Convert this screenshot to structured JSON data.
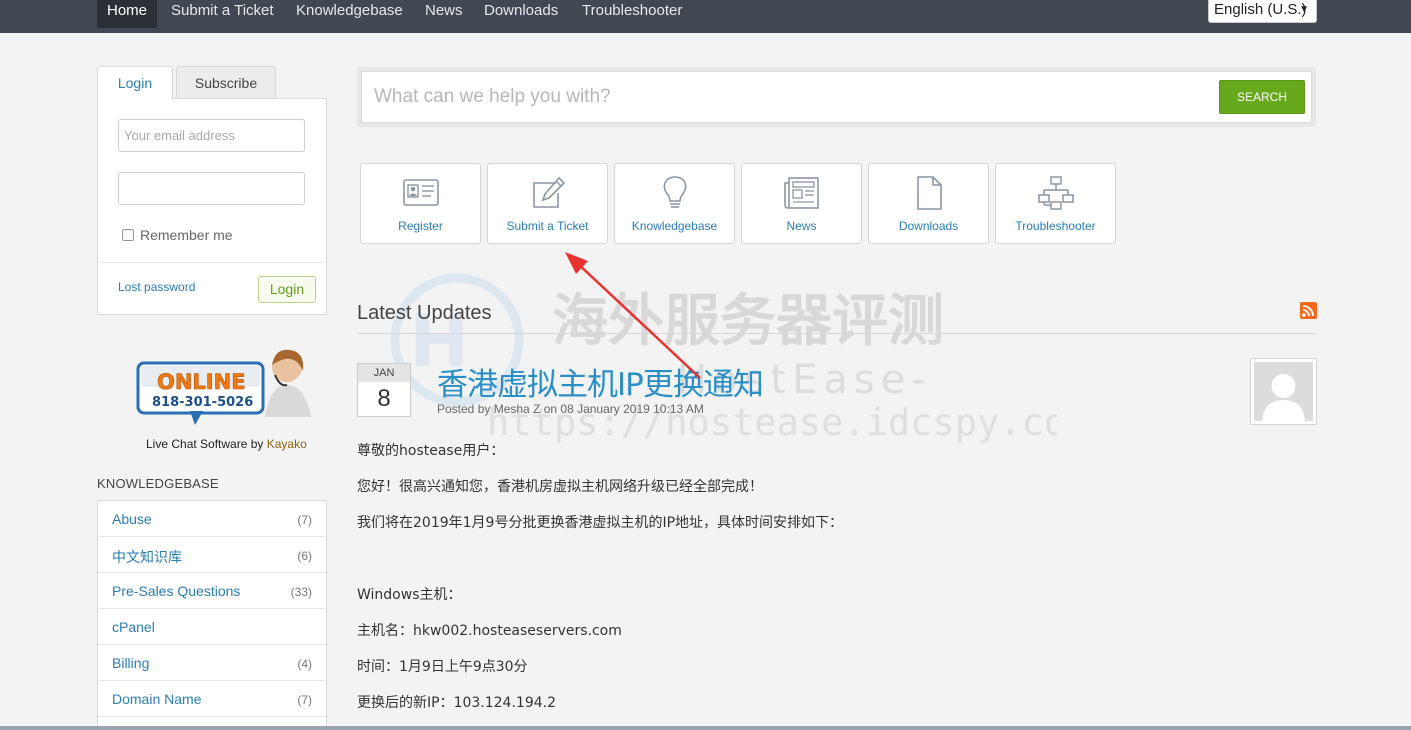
{
  "nav": {
    "items": [
      "Home",
      "Submit a Ticket",
      "Knowledgebase",
      "News",
      "Downloads",
      "Troubleshooter"
    ],
    "language": "English (U.S.)"
  },
  "login": {
    "tab_login": "Login",
    "tab_subscribe": "Subscribe",
    "email_placeholder": "Your email address",
    "password_value": "",
    "remember_label": "Remember me",
    "lost_password": "Lost password",
    "login_button": "Login"
  },
  "livechat": {
    "badge_text": "ONLINE",
    "phone": "818-301-5026",
    "caption_prefix": "Live Chat Software by",
    "caption_brand": "Kayako"
  },
  "knowledgebase": {
    "heading": "KNOWLEDGEBASE",
    "items": [
      {
        "label": "Abuse",
        "count": "(7)"
      },
      {
        "label": "中文知识库",
        "count": "(6)"
      },
      {
        "label": "Pre-Sales Questions",
        "count": "(33)"
      },
      {
        "label": "cPanel",
        "count": ""
      },
      {
        "label": "Billing",
        "count": "(4)"
      },
      {
        "label": "Domain Name",
        "count": "(7)"
      }
    ]
  },
  "search": {
    "placeholder": "What can we help you with?",
    "button": "SEARCH"
  },
  "tiles": [
    {
      "label": "Register",
      "icon": "register-card-icon"
    },
    {
      "label": "Submit a Ticket",
      "icon": "edit-pencil-icon"
    },
    {
      "label": "Knowledgebase",
      "icon": "lightbulb-icon"
    },
    {
      "label": "News",
      "icon": "newspaper-icon"
    },
    {
      "label": "Downloads",
      "icon": "document-icon"
    },
    {
      "label": "Troubleshooter",
      "icon": "sitemap-icon"
    }
  ],
  "watermark": {
    "line1": "海外服务器评测",
    "line2": "HostEase-",
    "line3": "https://hostease.idcspy.com/"
  },
  "updates": {
    "heading": "Latest Updates",
    "post": {
      "month": "JAN",
      "day": "8",
      "title": "香港虚拟主机IP更换通知",
      "meta": "Posted by Mesha Z on 08 January 2019 10:13 AM",
      "lines": [
        "尊敬的hostease用户：",
        "您好！很高兴通知您，香港机房虚拟主机网络升级已经全部完成！",
        "我们将在2019年1月9号分批更换香港虚拟主机的IP地址，具体时间安排如下：",
        "Windows主机：",
        "主机名：hkw002.hosteaseservers.com",
        "时间：1月9日上午9点30分",
        "更换后的新IP：103.124.194.2"
      ]
    }
  },
  "colors": {
    "nav_bg": "#414852",
    "link": "#2a7db5",
    "title": "#2a8fc6",
    "search_button": "#67a91c",
    "arrow": "#e8322f"
  }
}
